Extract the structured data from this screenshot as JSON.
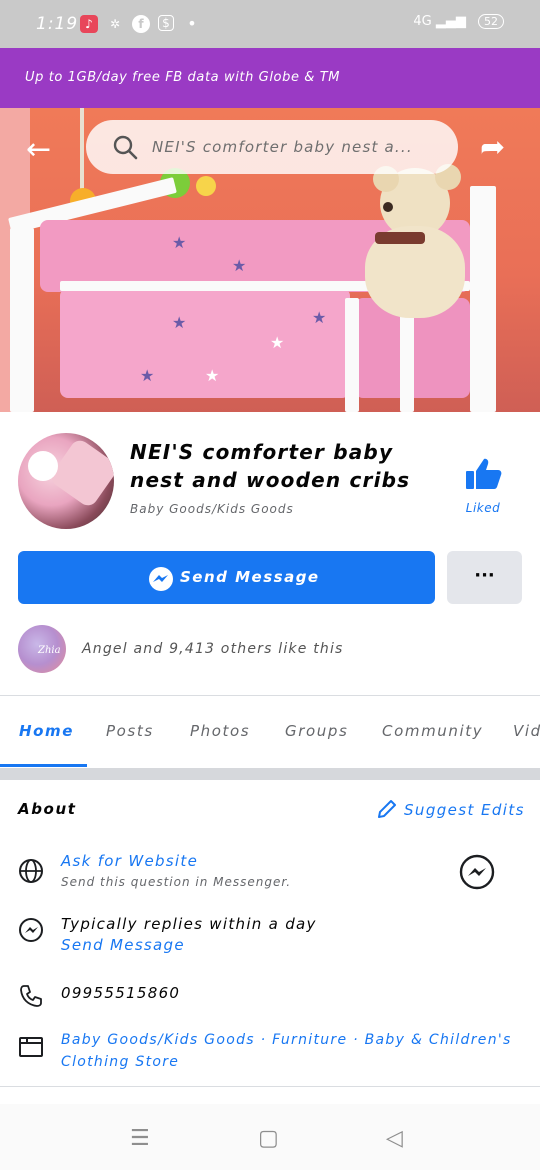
{
  "status_bar": {
    "time": "1:19",
    "network": "4G",
    "battery": "52"
  },
  "promo": {
    "text": "Up to 1GB/day free FB data with Globe & TM"
  },
  "search": {
    "placeholder": "NEI'S comforter baby nest a..."
  },
  "page": {
    "title": "NEI'S comforter baby nest and wooden cribs",
    "category": "Baby Goods/Kids Goods",
    "like_label": "Liked",
    "send_message_label": "Send Message",
    "more_label": "···",
    "likers_text": "Angel and 9,413 others like this",
    "likers_avatar_text": "Zhia"
  },
  "tabs": [
    {
      "label": "Home",
      "active": true
    },
    {
      "label": "Posts",
      "active": false
    },
    {
      "label": "Photos",
      "active": false
    },
    {
      "label": "Groups",
      "active": false
    },
    {
      "label": "Community",
      "active": false
    },
    {
      "label": "Vid",
      "active": false
    }
  ],
  "about": {
    "heading": "About",
    "suggest_edits": "Suggest Edits",
    "website_title": "Ask for Website",
    "website_sub": "Send this question in Messenger.",
    "reply_text": "Typically replies within a day",
    "reply_action": "Send Message",
    "phone": "09955515860",
    "categories_line1": "Baby Goods/Kids Goods · Furniture · Baby & Children's",
    "categories_line2": "Clothing Store"
  },
  "colors": {
    "accent": "#1877f2",
    "promo_bg": "#9a3ac4",
    "cover_wall": "#f07a58",
    "crib_bedding": "#f29ac2"
  }
}
